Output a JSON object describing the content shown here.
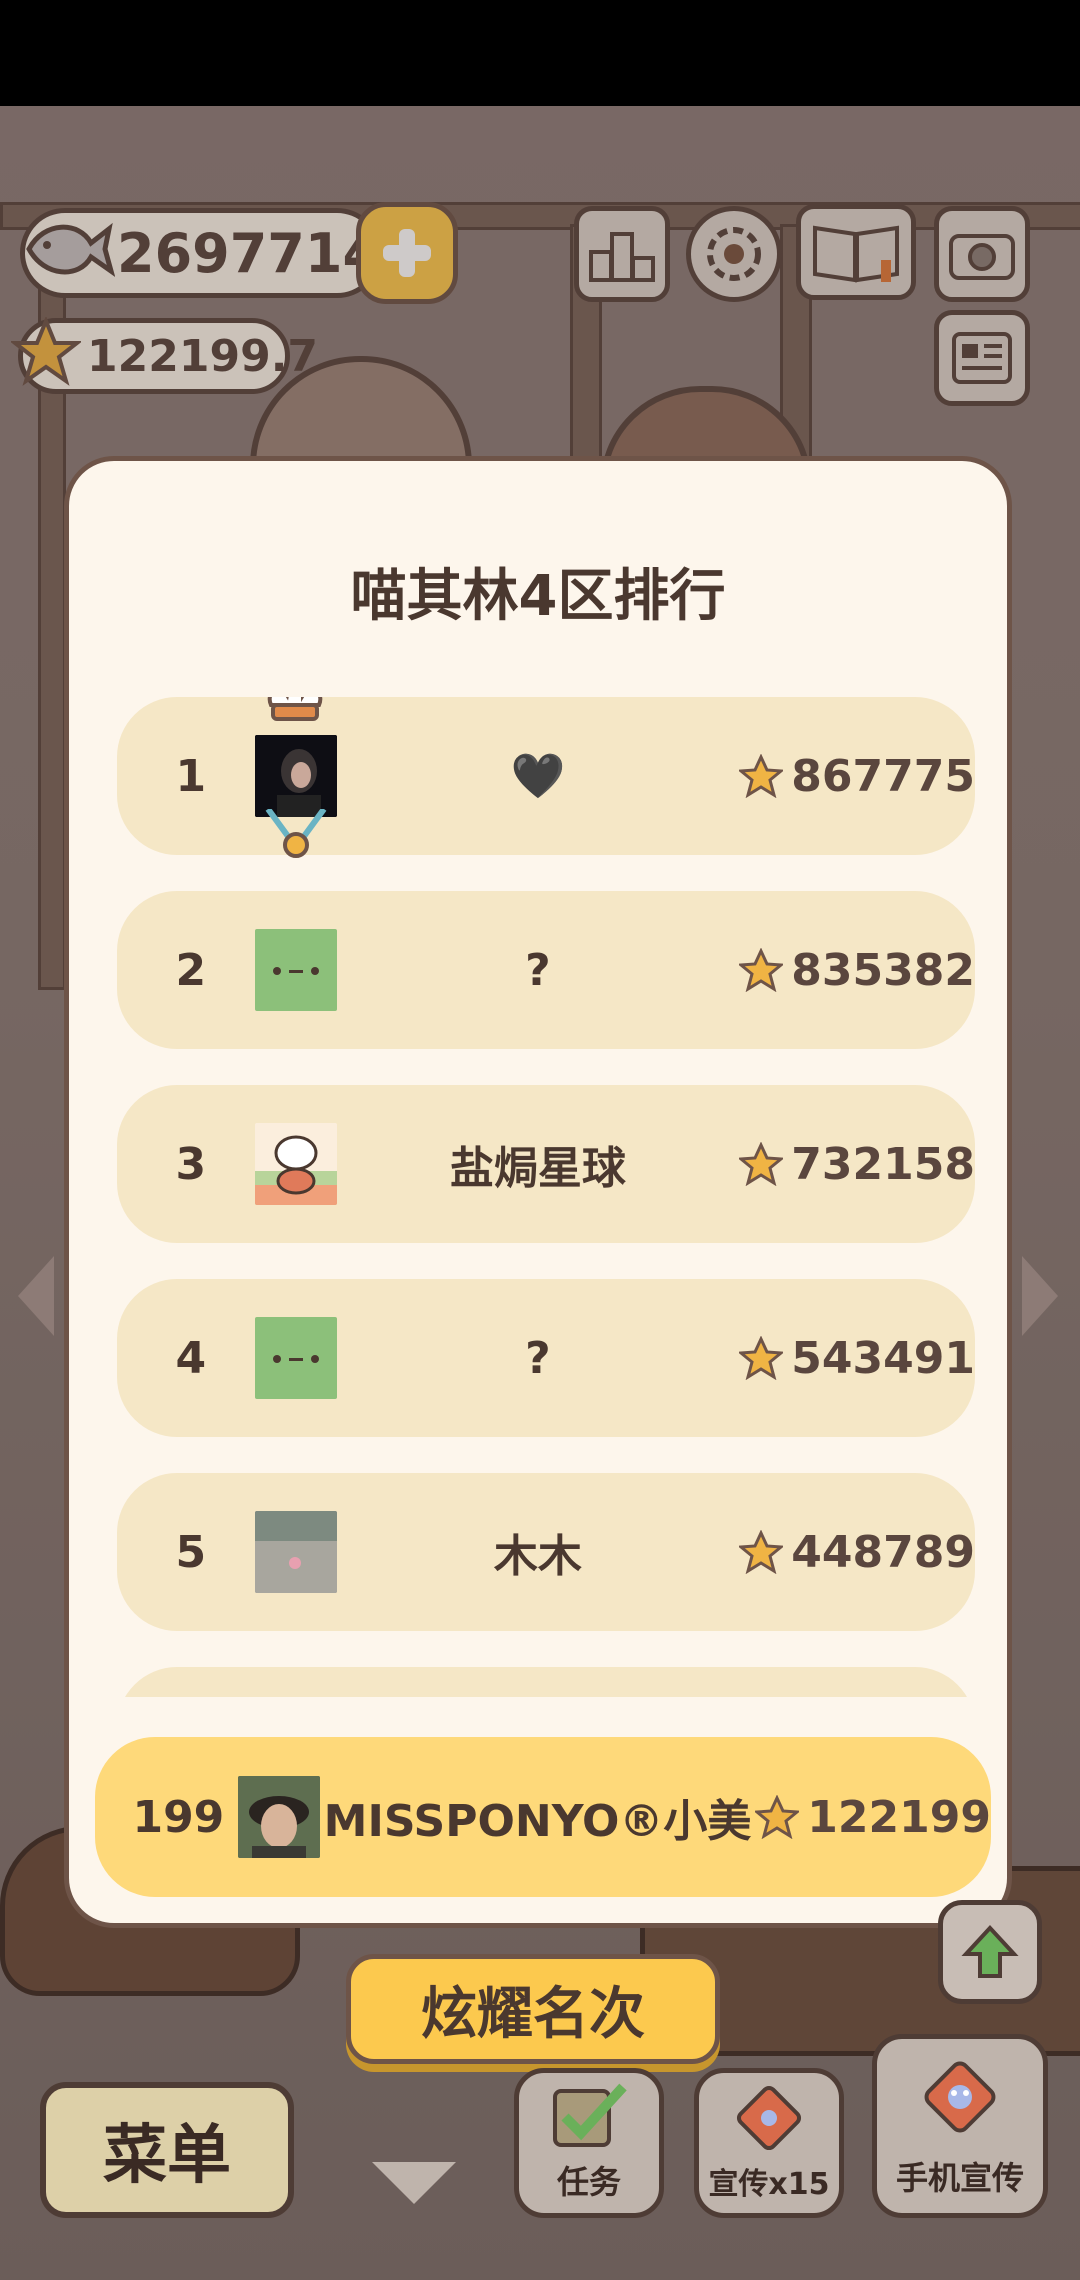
{
  "hud": {
    "fish_count": "2697714",
    "star_count": "122199.7"
  },
  "dialog": {
    "title": "喵其林4区排行",
    "rows": [
      {
        "rank": "1",
        "name": "🖤",
        "score": "867775",
        "avatar": "photo-dark"
      },
      {
        "rank": "2",
        "name": "?",
        "score": "835382",
        "avatar": "green-face"
      },
      {
        "rank": "3",
        "name": "盐焗星球",
        "score": "732158",
        "avatar": "cat-chef"
      },
      {
        "rank": "4",
        "name": "?",
        "score": "543491",
        "avatar": "green-face"
      },
      {
        "rank": "5",
        "name": "木木",
        "score": "448789",
        "avatar": "photo-park"
      }
    ],
    "me": {
      "rank": "199",
      "name": "MISSPONYO®小美",
      "score": "122199",
      "avatar": "photo-selfie"
    }
  },
  "buttons": {
    "show_rank": "炫耀名次",
    "menu": "菜单",
    "tasks": "任务",
    "promo": "宣传x15",
    "phone_promo": "手机宣传"
  },
  "colors": {
    "dialog_bg": "#fdf6ec",
    "row_bg": "#f5e7c6",
    "me_row_bg": "#fed97a",
    "button_yellow": "#fcc94e",
    "text_brown": "#4a382f"
  }
}
